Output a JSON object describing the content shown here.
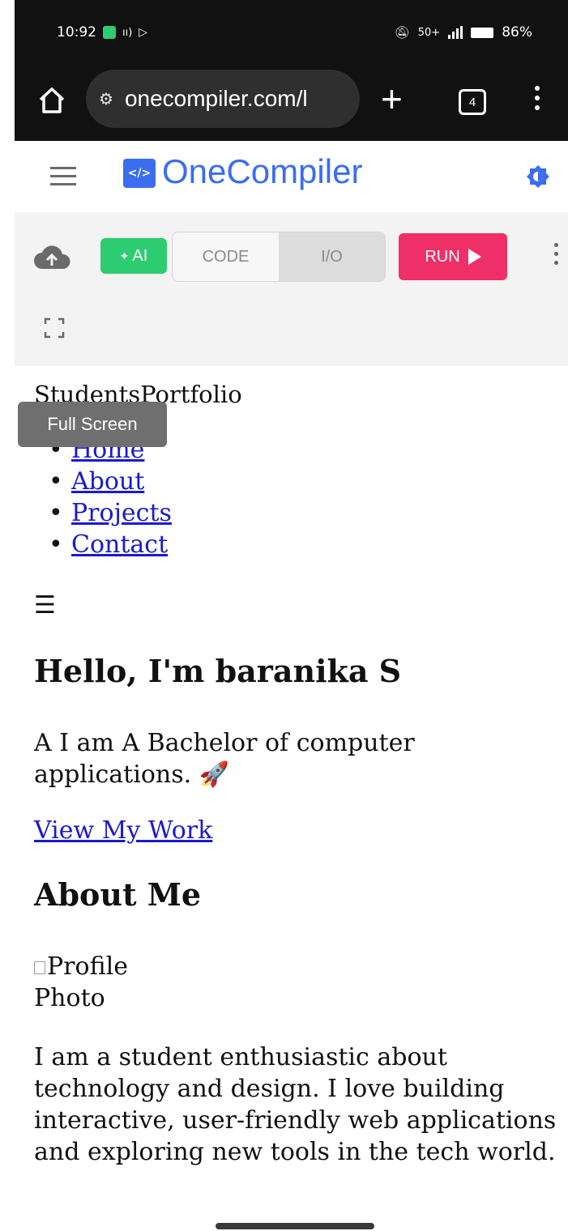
{
  "status_bar": {
    "time": "10:92",
    "network": "50+",
    "battery": "86%"
  },
  "browser": {
    "url": "onecompiler.com/l",
    "tab_count": "4"
  },
  "header": {
    "logo_mark": "</>",
    "brand": "OneCompiler"
  },
  "toolbar": {
    "ai_label": "AI",
    "tabs": [
      "CODE",
      "I/O"
    ],
    "run_label": "RUN",
    "tooltip": "Full Screen"
  },
  "preview": {
    "site_title": "StudentsPortfolio",
    "nav": [
      "Home",
      "About",
      "Projects",
      "Contact"
    ],
    "menu_toggle": "☰",
    "hero_title": "Hello, I'm baranika S",
    "hero_text": "A I am A Bachelor of computer applications.",
    "hero_emoji": "🚀",
    "cta_link": "View My Work",
    "about_title": "About Me",
    "profile_alt": "Profile Photo",
    "about_text": "I am a student enthusiastic about technology and design. I love building interactive, user-friendly web applications and exploring new tools in the tech world."
  },
  "colors": {
    "brand_blue": "#3a6df0",
    "ai_green": "#2ecc71",
    "run_pink": "#ee2f68",
    "link_blue": "#1a1acc"
  },
  "icons": [
    "home-icon",
    "tune-icon",
    "plus-icon",
    "tabs-icon",
    "kebab-icon",
    "hamburger-icon",
    "theme-icon",
    "cloud-upload-icon",
    "sparkle-icon",
    "play-icon",
    "more-icon",
    "fullscreen-icon"
  ]
}
